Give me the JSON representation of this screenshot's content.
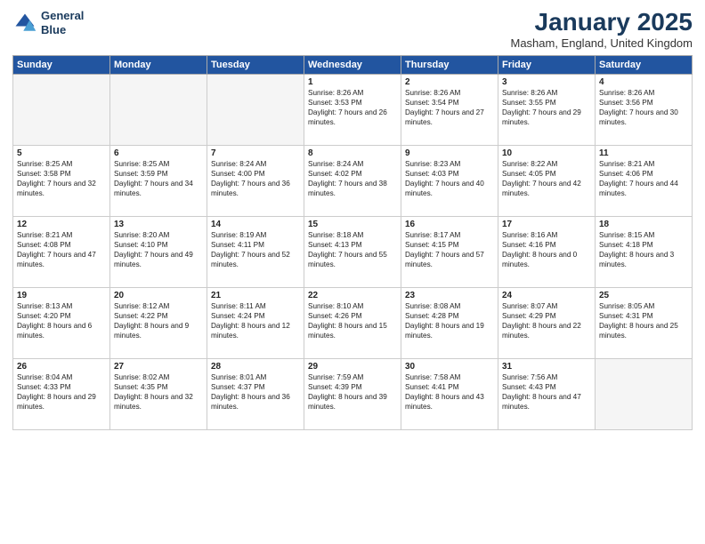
{
  "header": {
    "logo_line1": "General",
    "logo_line2": "Blue",
    "month": "January 2025",
    "location": "Masham, England, United Kingdom"
  },
  "weekdays": [
    "Sunday",
    "Monday",
    "Tuesday",
    "Wednesday",
    "Thursday",
    "Friday",
    "Saturday"
  ],
  "weeks": [
    [
      {
        "day": "",
        "text": "",
        "empty": true
      },
      {
        "day": "",
        "text": "",
        "empty": true
      },
      {
        "day": "",
        "text": "",
        "empty": true
      },
      {
        "day": "1",
        "text": "Sunrise: 8:26 AM\nSunset: 3:53 PM\nDaylight: 7 hours and 26 minutes."
      },
      {
        "day": "2",
        "text": "Sunrise: 8:26 AM\nSunset: 3:54 PM\nDaylight: 7 hours and 27 minutes."
      },
      {
        "day": "3",
        "text": "Sunrise: 8:26 AM\nSunset: 3:55 PM\nDaylight: 7 hours and 29 minutes."
      },
      {
        "day": "4",
        "text": "Sunrise: 8:26 AM\nSunset: 3:56 PM\nDaylight: 7 hours and 30 minutes."
      }
    ],
    [
      {
        "day": "5",
        "text": "Sunrise: 8:25 AM\nSunset: 3:58 PM\nDaylight: 7 hours and 32 minutes."
      },
      {
        "day": "6",
        "text": "Sunrise: 8:25 AM\nSunset: 3:59 PM\nDaylight: 7 hours and 34 minutes."
      },
      {
        "day": "7",
        "text": "Sunrise: 8:24 AM\nSunset: 4:00 PM\nDaylight: 7 hours and 36 minutes."
      },
      {
        "day": "8",
        "text": "Sunrise: 8:24 AM\nSunset: 4:02 PM\nDaylight: 7 hours and 38 minutes."
      },
      {
        "day": "9",
        "text": "Sunrise: 8:23 AM\nSunset: 4:03 PM\nDaylight: 7 hours and 40 minutes."
      },
      {
        "day": "10",
        "text": "Sunrise: 8:22 AM\nSunset: 4:05 PM\nDaylight: 7 hours and 42 minutes."
      },
      {
        "day": "11",
        "text": "Sunrise: 8:21 AM\nSunset: 4:06 PM\nDaylight: 7 hours and 44 minutes."
      }
    ],
    [
      {
        "day": "12",
        "text": "Sunrise: 8:21 AM\nSunset: 4:08 PM\nDaylight: 7 hours and 47 minutes."
      },
      {
        "day": "13",
        "text": "Sunrise: 8:20 AM\nSunset: 4:10 PM\nDaylight: 7 hours and 49 minutes."
      },
      {
        "day": "14",
        "text": "Sunrise: 8:19 AM\nSunset: 4:11 PM\nDaylight: 7 hours and 52 minutes."
      },
      {
        "day": "15",
        "text": "Sunrise: 8:18 AM\nSunset: 4:13 PM\nDaylight: 7 hours and 55 minutes."
      },
      {
        "day": "16",
        "text": "Sunrise: 8:17 AM\nSunset: 4:15 PM\nDaylight: 7 hours and 57 minutes."
      },
      {
        "day": "17",
        "text": "Sunrise: 8:16 AM\nSunset: 4:16 PM\nDaylight: 8 hours and 0 minutes."
      },
      {
        "day": "18",
        "text": "Sunrise: 8:15 AM\nSunset: 4:18 PM\nDaylight: 8 hours and 3 minutes."
      }
    ],
    [
      {
        "day": "19",
        "text": "Sunrise: 8:13 AM\nSunset: 4:20 PM\nDaylight: 8 hours and 6 minutes."
      },
      {
        "day": "20",
        "text": "Sunrise: 8:12 AM\nSunset: 4:22 PM\nDaylight: 8 hours and 9 minutes."
      },
      {
        "day": "21",
        "text": "Sunrise: 8:11 AM\nSunset: 4:24 PM\nDaylight: 8 hours and 12 minutes."
      },
      {
        "day": "22",
        "text": "Sunrise: 8:10 AM\nSunset: 4:26 PM\nDaylight: 8 hours and 15 minutes."
      },
      {
        "day": "23",
        "text": "Sunrise: 8:08 AM\nSunset: 4:28 PM\nDaylight: 8 hours and 19 minutes."
      },
      {
        "day": "24",
        "text": "Sunrise: 8:07 AM\nSunset: 4:29 PM\nDaylight: 8 hours and 22 minutes."
      },
      {
        "day": "25",
        "text": "Sunrise: 8:05 AM\nSunset: 4:31 PM\nDaylight: 8 hours and 25 minutes."
      }
    ],
    [
      {
        "day": "26",
        "text": "Sunrise: 8:04 AM\nSunset: 4:33 PM\nDaylight: 8 hours and 29 minutes."
      },
      {
        "day": "27",
        "text": "Sunrise: 8:02 AM\nSunset: 4:35 PM\nDaylight: 8 hours and 32 minutes."
      },
      {
        "day": "28",
        "text": "Sunrise: 8:01 AM\nSunset: 4:37 PM\nDaylight: 8 hours and 36 minutes."
      },
      {
        "day": "29",
        "text": "Sunrise: 7:59 AM\nSunset: 4:39 PM\nDaylight: 8 hours and 39 minutes."
      },
      {
        "day": "30",
        "text": "Sunrise: 7:58 AM\nSunset: 4:41 PM\nDaylight: 8 hours and 43 minutes."
      },
      {
        "day": "31",
        "text": "Sunrise: 7:56 AM\nSunset: 4:43 PM\nDaylight: 8 hours and 47 minutes."
      },
      {
        "day": "",
        "text": "",
        "empty": true,
        "shaded": true
      }
    ]
  ]
}
